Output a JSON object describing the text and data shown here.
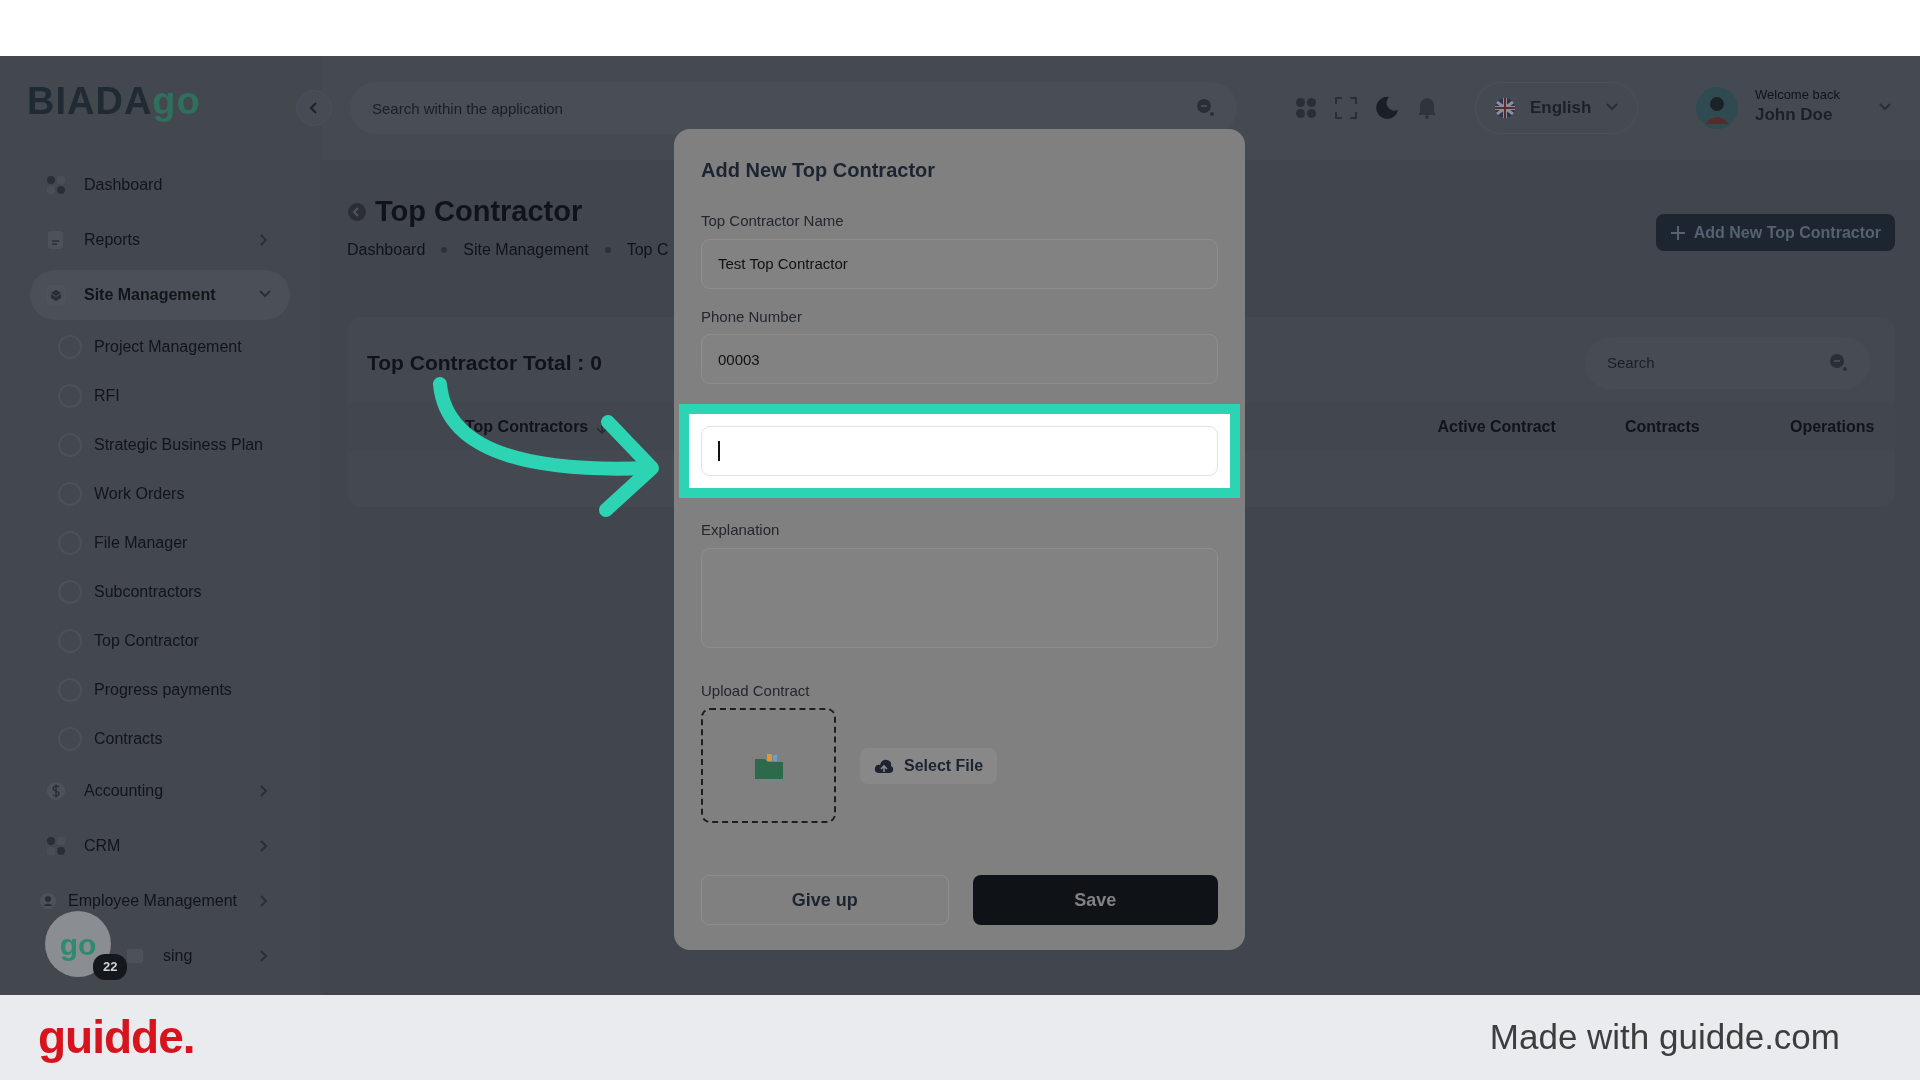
{
  "header": {
    "logo_text": "BIADA",
    "logo_accent": "go",
    "search_placeholder": "Search within the application",
    "language": "English",
    "welcome": "Welcome back",
    "user": "John Doe"
  },
  "sidebar": {
    "items": [
      {
        "label": "Dashboard",
        "kind": "link",
        "selected": false
      },
      {
        "label": "Reports",
        "kind": "group",
        "selected": false,
        "expanded": false
      },
      {
        "label": "Site Management",
        "kind": "group",
        "selected": true,
        "expanded": true,
        "children": [
          {
            "label": "Project Management",
            "selected": false
          },
          {
            "label": "RFI",
            "selected": false
          },
          {
            "label": "Strategic Business Plan",
            "selected": false
          },
          {
            "label": "Work Orders",
            "selected": false
          },
          {
            "label": "File Manager",
            "selected": false
          },
          {
            "label": "Subcontractors",
            "selected": false
          },
          {
            "label": "Top Contractor",
            "selected": false
          },
          {
            "label": "Progress payments",
            "selected": false
          },
          {
            "label": "Contracts",
            "selected": false
          }
        ]
      },
      {
        "label": "Accounting",
        "kind": "group",
        "selected": false,
        "expanded": false
      },
      {
        "label": "CRM",
        "kind": "group",
        "selected": false,
        "expanded": false
      },
      {
        "label": "Employee Management",
        "kind": "group",
        "selected": false,
        "expanded": false
      },
      {
        "label": "sing",
        "kind": "group",
        "selected": false,
        "expanded": false
      }
    ]
  },
  "help_bubble": {
    "logo": "go",
    "badge": "22"
  },
  "page": {
    "title": "Top Contractor",
    "breadcrumbs": [
      "Dashboard",
      "Site Management",
      "Top C"
    ],
    "add_button": "Add New Top Contractor",
    "card": {
      "title": "Top Contractor Total : 0",
      "search_placeholder": "Search",
      "columns": [
        {
          "label": "Top Contractors",
          "sorted": true
        },
        {
          "label": "Active Contract",
          "sorted": false
        },
        {
          "label": "Contracts",
          "sorted": false
        },
        {
          "label": "Operations",
          "sorted": false
        }
      ]
    }
  },
  "modal": {
    "title": "Add New Top Contractor",
    "fields": [
      {
        "kind": "input",
        "label": "Top Contractor Name",
        "value": "Test Top Contractor",
        "focused": false,
        "highlighted": false
      },
      {
        "kind": "input",
        "label": "Phone Number",
        "value": "00003",
        "focused": false,
        "highlighted": false
      },
      {
        "kind": "input",
        "focused": true,
        "highlighted": true
      },
      {
        "kind": "textarea",
        "label": "Explanation",
        "focused": false,
        "highlighted": false
      }
    ],
    "upload": {
      "label": "Upload Contract",
      "button": "Select File"
    },
    "buttons": [
      {
        "label": "Give up",
        "kind": "secondary"
      },
      {
        "label": "Save",
        "kind": "primary"
      }
    ]
  },
  "footer": {
    "brand": "guidde.",
    "credit": "Made with guidde.com"
  }
}
